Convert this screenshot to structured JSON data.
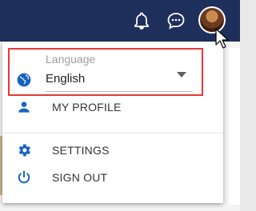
{
  "topbar": {
    "icons": {
      "notifications": "bell-icon",
      "chat": "chat-bubble-icon"
    }
  },
  "menu": {
    "language": {
      "label": "Language",
      "selected": "English",
      "icon": "globe-icon"
    },
    "items": [
      {
        "label": "MY PROFILE",
        "icon": "person-icon"
      },
      {
        "label": "SETTINGS",
        "icon": "gear-icon"
      },
      {
        "label": "SIGN OUT",
        "icon": "power-icon"
      }
    ]
  },
  "colors": {
    "topbar": "#1f2f5c",
    "icon_blue": "#1565c0",
    "highlight_border": "#e53935"
  }
}
